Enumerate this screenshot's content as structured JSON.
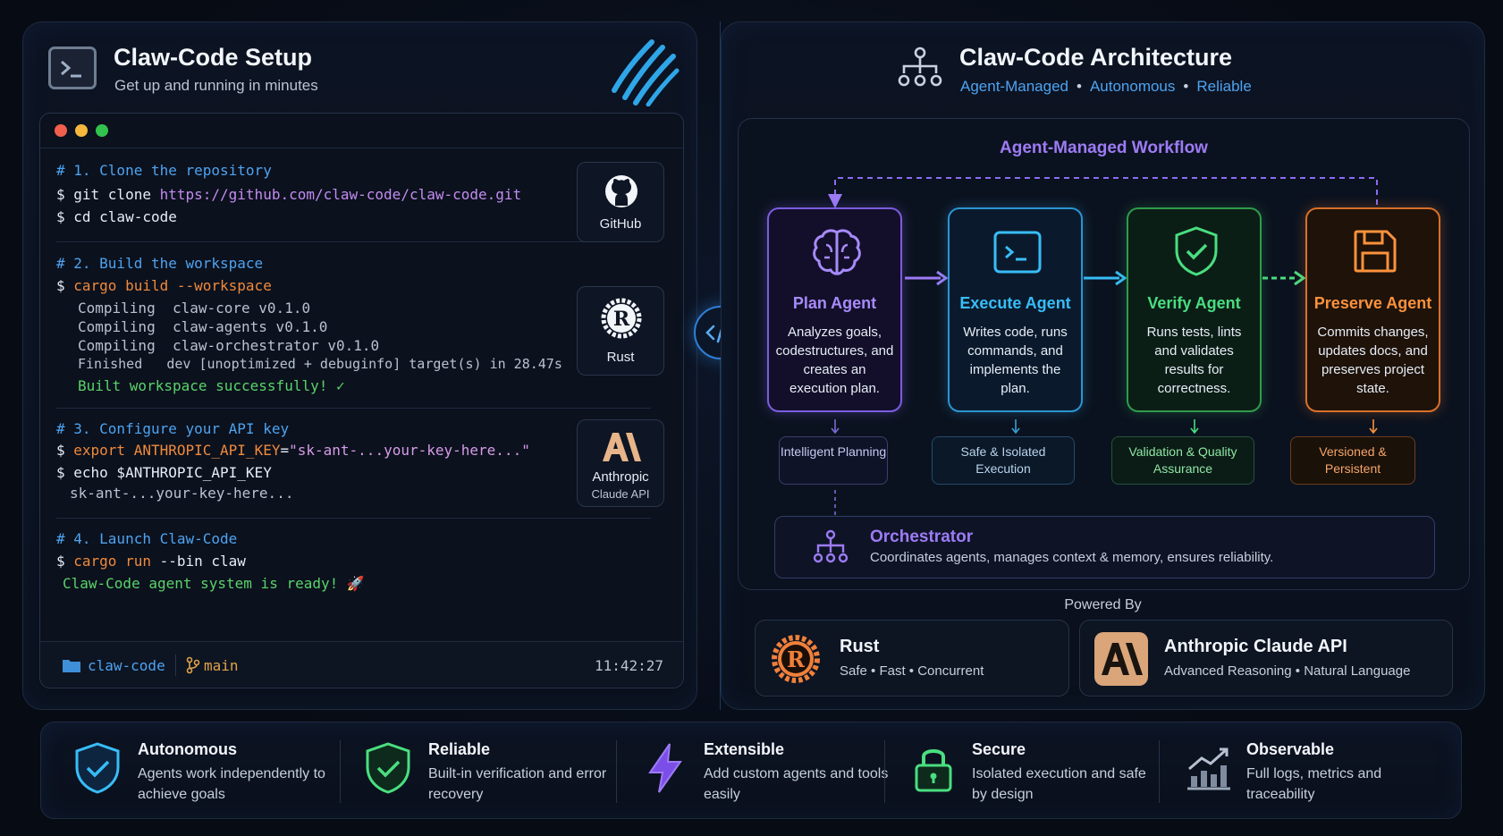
{
  "setup": {
    "title": "Claw-Code Setup",
    "subtitle": "Get up and running in minutes",
    "steps": [
      {
        "comment": "# 1. Clone the repository",
        "cmd1_prefix": "$ git clone ",
        "cmd1_url": "https://github.com/claw-code/claw-code.git",
        "cmd2": "$ cd claw-code"
      },
      {
        "comment": "# 2. Build the workspace",
        "prompt": "$ ",
        "cmd": "cargo build --workspace",
        "output": [
          "Compiling  claw-core v0.1.0",
          "Compiling  claw-agents v0.1.0",
          "Compiling  claw-orchestrator v0.1.0",
          "Finished   dev [unoptimized + debuginfo] target(s) in 28.47s"
        ],
        "success": "Built workspace successfully! ✓"
      },
      {
        "comment": "# 3. Configure your API key",
        "export_kw": "export",
        "var": "ANTHROPIC_API_KEY",
        "eq": "=",
        "value": "\"sk-ant-...your-key-here...\"",
        "echo": "$ echo $ANTHROPIC_API_KEY",
        "echo_out": "sk-ant-...your-key-here..."
      },
      {
        "comment": "# 4. Launch Claw-Code",
        "cargo": "cargo run",
        "rest": " --bin claw",
        "ready": "Claw-Code agent system is ready! 🚀"
      }
    ],
    "logos": [
      {
        "label": "GitHub",
        "icon": "github-icon"
      },
      {
        "label": "Rust",
        "icon": "rust-icon"
      },
      {
        "label": "Anthropic",
        "sublabel": "Claude API",
        "icon": "anthropic-icon"
      }
    ],
    "footer": {
      "folder": "claw-code",
      "branch": "main",
      "time": "11:42:27"
    }
  },
  "architecture": {
    "title": "Claw-Code Architecture",
    "tags": [
      "Agent-Managed",
      "Autonomous",
      "Reliable"
    ],
    "workflow_title": "Agent-Managed Workflow",
    "agents": [
      {
        "name": "Plan Agent",
        "desc": "Analyzes goals, codestructures, and creates an execution plan.",
        "tag": "Intelligent Planning",
        "color": "#a78bfa",
        "icon": "brain-icon"
      },
      {
        "name": "Execute Agent",
        "desc": "Writes code, runs commands, and implements the plan.",
        "tag": "Safe & Isolated Execution",
        "color": "#38bdf8",
        "icon": "terminal-icon"
      },
      {
        "name": "Verify Agent",
        "desc": "Runs tests, lints and validates results for correctness.",
        "tag": "Validation & Quality Assurance",
        "color": "#4ade80",
        "icon": "shield-check-icon"
      },
      {
        "name": "Preserve Agent",
        "desc": "Commits changes, updates docs, and preserves project state.",
        "tag": "Versioned & Persistent",
        "color": "#fb923c",
        "icon": "save-icon"
      }
    ],
    "orchestrator": {
      "title": "Orchestrator",
      "desc": "Coordinates agents, manages context & memory, ensures reliability."
    },
    "powered_by": "Powered By",
    "providers": [
      {
        "name": "Rust",
        "desc": "Safe • Fast • Concurrent"
      },
      {
        "name": "Anthropic Claude API",
        "desc": "Advanced Reasoning • Natural Language"
      }
    ]
  },
  "features": [
    {
      "title": "Autonomous",
      "desc": "Agents work independently to achieve goals",
      "icon": "shield-check-icon",
      "color": "#38bdf8"
    },
    {
      "title": "Reliable",
      "desc": "Built-in verification and error recovery",
      "icon": "shield-check-icon",
      "color": "#4ade80"
    },
    {
      "title": "Extensible",
      "desc": "Add custom agents and tools easily",
      "icon": "lightning-icon",
      "color": "#8b5cf6"
    },
    {
      "title": "Secure",
      "desc": "Isolated execution and safe by design",
      "icon": "lock-icon",
      "color": "#4ade80"
    },
    {
      "title": "Observable",
      "desc": "Full logs, metrics and traceability",
      "icon": "chart-icon",
      "color": "#9aa6b8"
    }
  ]
}
